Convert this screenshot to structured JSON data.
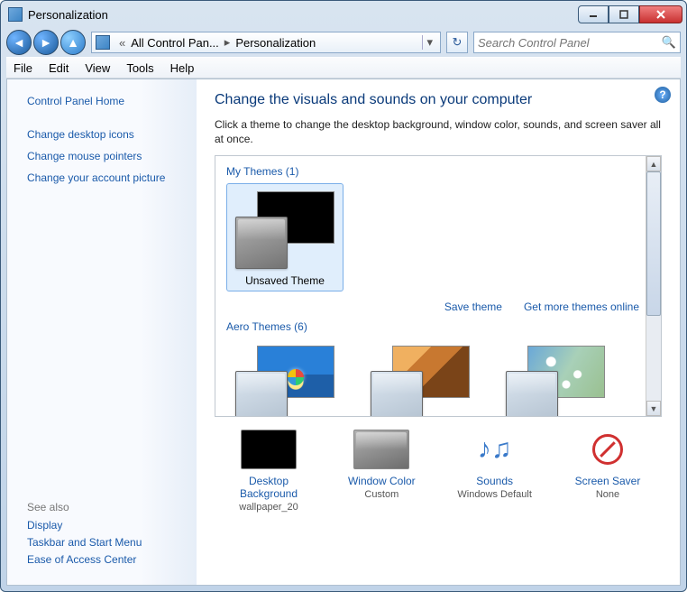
{
  "window": {
    "title": "Personalization"
  },
  "nav": {
    "breadcrumb_back": "All Control Pan...",
    "breadcrumb_current": "Personalization",
    "search_placeholder": "Search Control Panel"
  },
  "menu": {
    "file": "File",
    "edit": "Edit",
    "view": "View",
    "tools": "Tools",
    "help": "Help"
  },
  "sidebar": {
    "control_panel_home": "Control Panel Home",
    "links": [
      "Change desktop icons",
      "Change mouse pointers",
      "Change your account picture"
    ],
    "see_also_hdr": "See also",
    "see_also": [
      "Display",
      "Taskbar and Start Menu",
      "Ease of Access Center"
    ]
  },
  "main": {
    "title": "Change the visuals and sounds on your computer",
    "desc": "Click a theme to change the desktop background, window color, sounds, and screen saver all at once.",
    "group_my_themes": "My Themes (1)",
    "unsaved_theme": "Unsaved Theme",
    "save_theme": "Save theme",
    "get_more": "Get more themes online",
    "group_aero": "Aero Themes (6)"
  },
  "bottom": {
    "desktop_bg": {
      "label": "Desktop Background",
      "sub": "wallpaper_20"
    },
    "window_color": {
      "label": "Window Color",
      "sub": "Custom"
    },
    "sounds": {
      "label": "Sounds",
      "sub": "Windows Default"
    },
    "screen_saver": {
      "label": "Screen Saver",
      "sub": "None"
    }
  }
}
